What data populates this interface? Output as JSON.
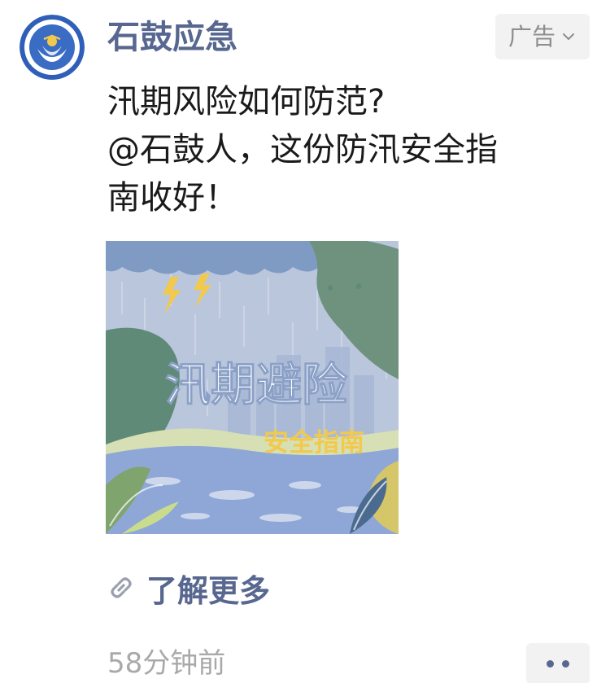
{
  "account": {
    "name": "石鼓应急",
    "avatar_icon": "emergency-management-logo"
  },
  "ad_tag": {
    "label": "广告",
    "icon": "chevron-down-icon"
  },
  "post": {
    "text_lines": [
      "汛期风险如何防范?",
      "@石鼓人，这份防汛安全指",
      "南收好！"
    ]
  },
  "ad_image": {
    "title": "汛期避险",
    "subtitle": "安全指南"
  },
  "learn_more": {
    "icon": "link-icon",
    "label": "了解更多"
  },
  "meta": {
    "timestamp": "58分钟前"
  },
  "more_button": {
    "icon": "more-dots-icon"
  },
  "colors": {
    "link_blue": "#58678f",
    "gray_text": "#a9a9a9",
    "tag_bg": "#f2f2f2",
    "image_sky": "#bac6dc",
    "image_water": "#8ea7d6",
    "image_title_yellow": "#f2c94c"
  }
}
